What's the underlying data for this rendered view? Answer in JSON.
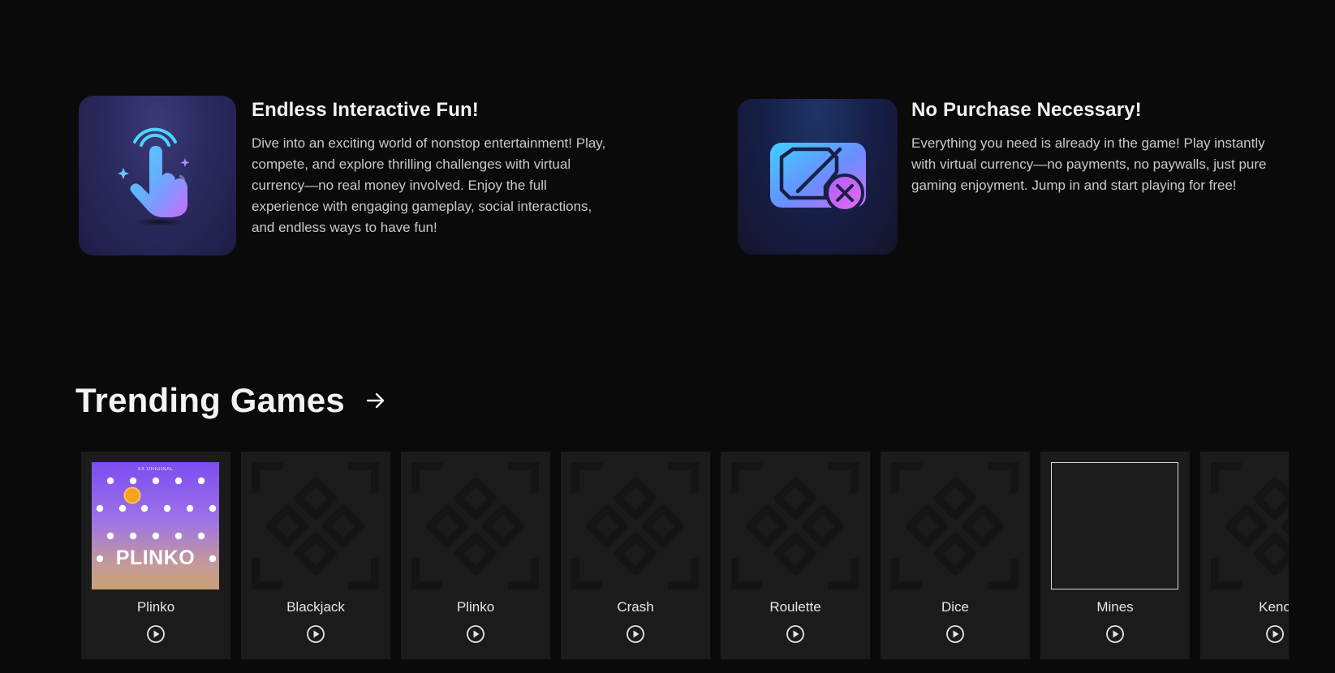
{
  "features": [
    {
      "title": "Endless Interactive Fun!",
      "description": "Dive into an exciting world of nonstop entertainment! Play, compete, and explore thrilling challenges with virtual currency—no real money involved. Enjoy the full experience with engaging gameplay, social interactions, and endless ways to have fun!",
      "icon": "tap-hand-icon"
    },
    {
      "title": "No Purchase Necessary!",
      "description": "Everything you need is already in the game! Play instantly with virtual currency—no payments, no paywalls, just pure gaming enjoyment. Jump in and start playing for free!",
      "icon": "ticket-cancel-icon"
    }
  ],
  "trending": {
    "title": "Trending Games",
    "arrow_icon": "arrow-right-icon",
    "games": [
      {
        "name": "Plinko",
        "thumbnail": "plinko-art",
        "thumb_text": "PLINKO",
        "thumb_badge": "XX ORIGINAL"
      },
      {
        "name": "Blackjack",
        "thumbnail": "placeholder"
      },
      {
        "name": "Plinko",
        "thumbnail": "placeholder"
      },
      {
        "name": "Crash",
        "thumbnail": "placeholder"
      },
      {
        "name": "Roulette",
        "thumbnail": "placeholder"
      },
      {
        "name": "Dice",
        "thumbnail": "placeholder"
      },
      {
        "name": "Mines",
        "thumbnail": "empty"
      },
      {
        "name": "Keno",
        "thumbnail": "placeholder"
      }
    ]
  },
  "colors": {
    "background": "#0a0a0b",
    "card": "#1b1b1c",
    "text": "#e6e6e8"
  }
}
